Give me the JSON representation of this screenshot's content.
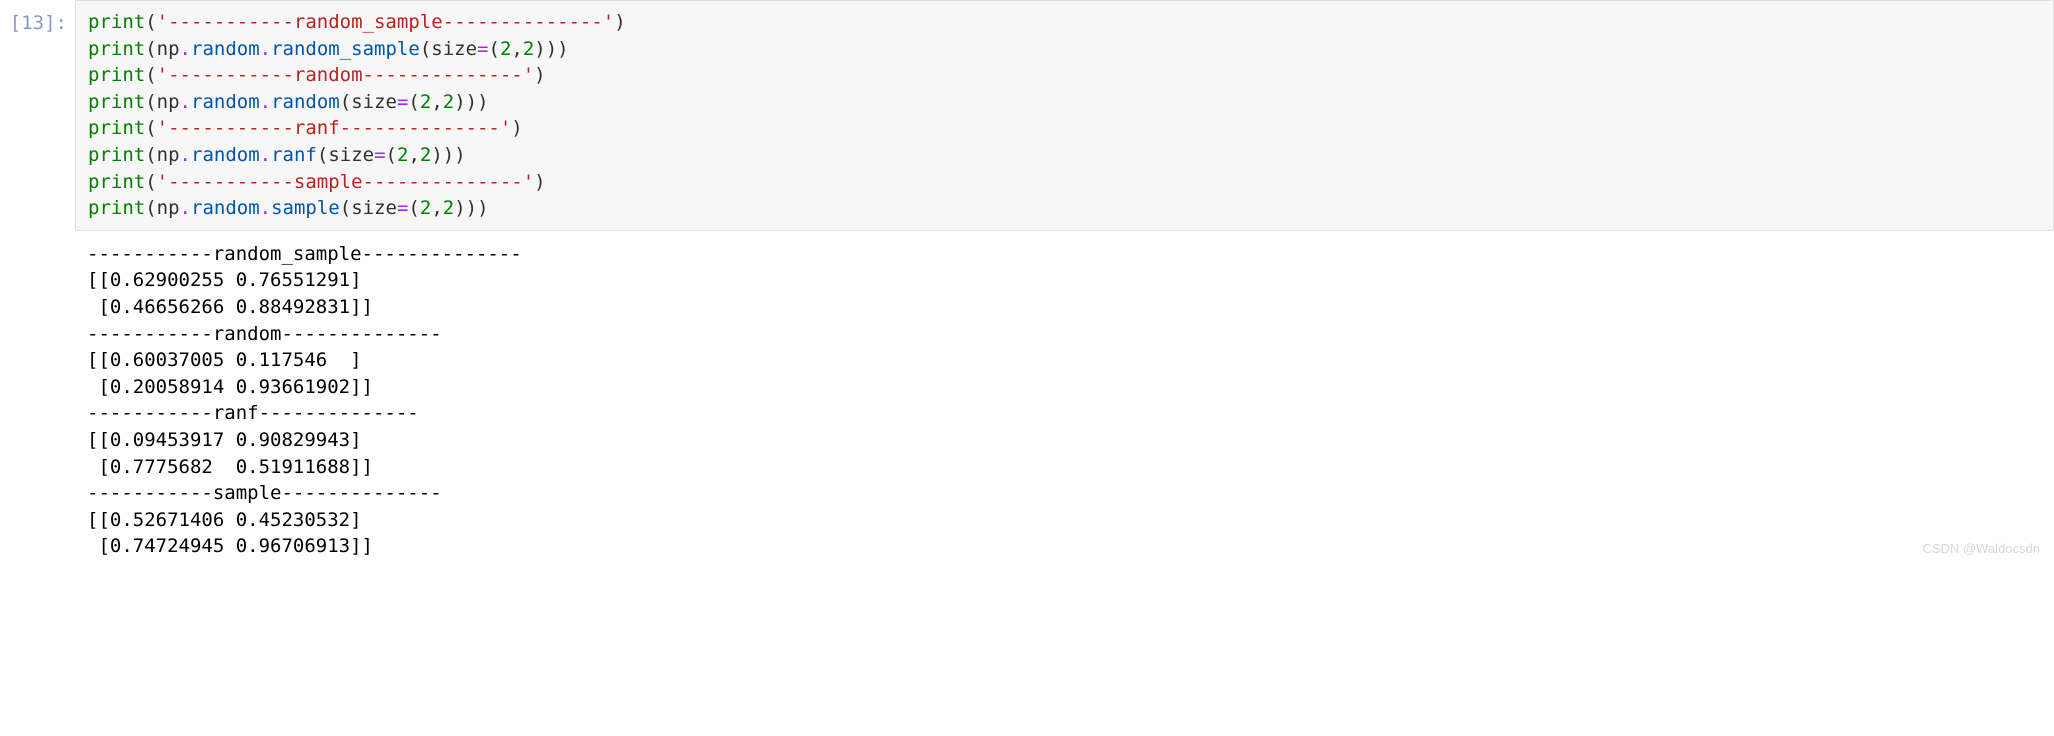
{
  "cell": {
    "prompt": "[13]:",
    "code": {
      "lines": [
        {
          "fn": "print",
          "arg_type": "string",
          "string": "'-----------random_sample--------------'"
        },
        {
          "fn": "print",
          "arg_type": "call",
          "obj": "np",
          "mod": "random",
          "method": "random_sample",
          "kw": "size",
          "v1": "2",
          "v2": "2"
        },
        {
          "fn": "print",
          "arg_type": "string",
          "string": "'-----------random--------------'"
        },
        {
          "fn": "print",
          "arg_type": "call",
          "obj": "np",
          "mod": "random",
          "method": "random",
          "kw": "size",
          "v1": "2",
          "v2": "2"
        },
        {
          "fn": "print",
          "arg_type": "string",
          "string": "'-----------ranf--------------'"
        },
        {
          "fn": "print",
          "arg_type": "call",
          "obj": "np",
          "mod": "random",
          "method": "ranf",
          "kw": "size",
          "v1": "2",
          "v2": "2"
        },
        {
          "fn": "print",
          "arg_type": "string",
          "string": "'-----------sample--------------'"
        },
        {
          "fn": "print",
          "arg_type": "call",
          "obj": "np",
          "mod": "random",
          "method": "sample",
          "kw": "size",
          "v1": "2",
          "v2": "2"
        }
      ]
    },
    "output": "-----------random_sample--------------\n[[0.62900255 0.76551291]\n [0.46656266 0.88492831]]\n-----------random--------------\n[[0.60037005 0.117546  ]\n [0.20058914 0.93661902]]\n-----------ranf--------------\n[[0.09453917 0.90829943]\n [0.7775682  0.51911688]]\n-----------sample--------------\n[[0.52671406 0.45230532]\n [0.74724945 0.96706913]]"
  },
  "watermark": "CSDN @Waldocsdn"
}
